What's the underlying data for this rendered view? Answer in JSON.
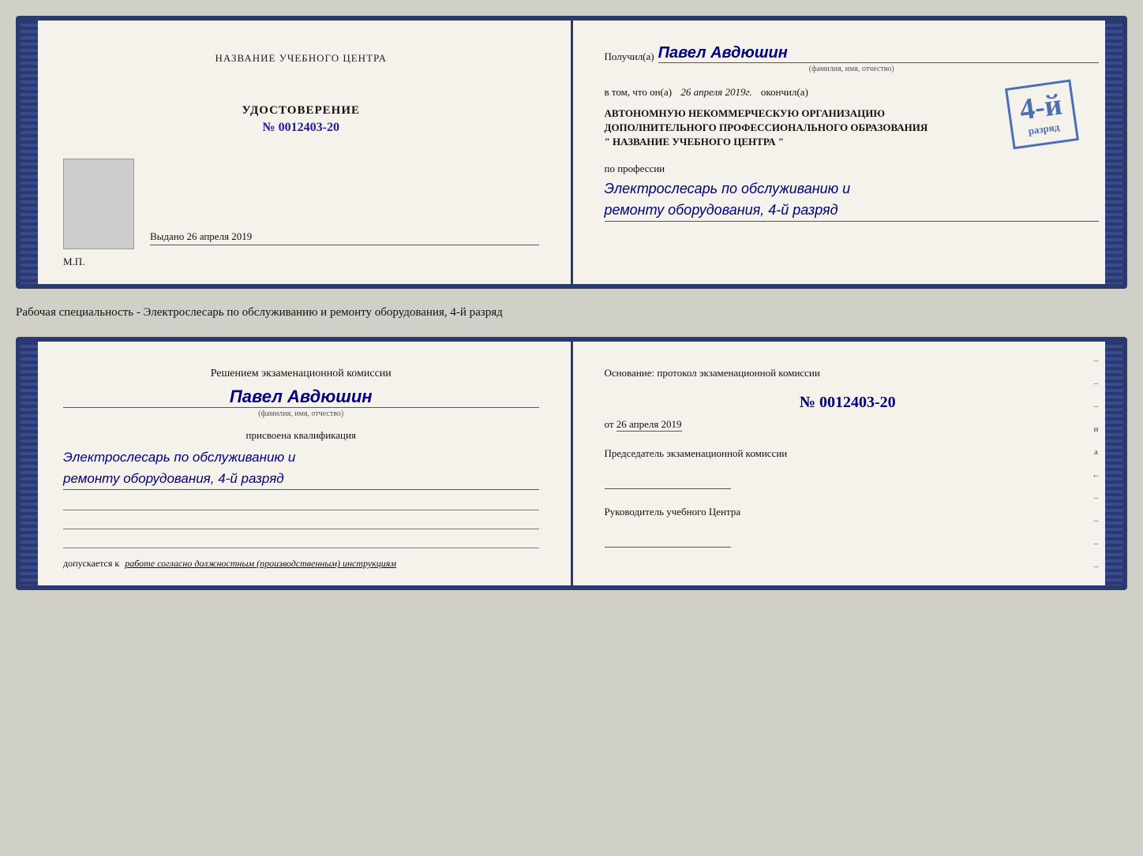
{
  "top_doc": {
    "left": {
      "school_name": "НАЗВАНИЕ УЧЕБНОГО ЦЕНТРА",
      "cert_title": "УДОСТОВЕРЕНИЕ",
      "cert_number": "№ 0012403-20",
      "issued_label": "Выдано",
      "issued_date": "26 апреля 2019",
      "mp_label": "М.П."
    },
    "right": {
      "received_label": "Получил(а)",
      "received_name": "Павел Авдюшин",
      "fio_hint": "(фамилия, имя, отчество)",
      "vtom_label": "в том, что он(а)",
      "vtom_date": "26 апреля 2019г.",
      "finished_label": "окончил(а)",
      "grade_number": "4-й",
      "org_line1": "АВТОНОМНУЮ НЕКОММЕРЧЕСКУЮ ОРГАНИЗАЦИЮ",
      "org_line2": "ДОПОЛНИТЕЛЬНОГО ПРОФЕССИОНАЛЬНОГО ОБРАЗОВАНИЯ",
      "org_name": "\"  НАЗВАНИЕ УЧЕБНОГО ЦЕНТРА  \"",
      "profession_label": "по профессии",
      "profession_line1": "Электрослесарь по обслуживанию и",
      "profession_line2": "ремонту оборудования, 4-й разряд",
      "stamp_text": "разряд"
    }
  },
  "middle": {
    "text": "Рабочая специальность - Электрослесарь по обслуживанию и ремонту оборудования, 4-й разряд"
  },
  "bottom_doc": {
    "left": {
      "decision_title": "Решением экзаменационной комиссии",
      "person_name": "Павел Авдюшин",
      "fio_hint": "(фамилия, имя, отчество)",
      "assigned_label": "присвоена квалификация",
      "qualification_line1": "Электрослесарь по обслуживанию и",
      "qualification_line2": "ремонту оборудования, 4-й разряд",
      "допускается_prefix": "допускается к",
      "допускается_text": "работе согласно должностным (производственным) инструкциям"
    },
    "right": {
      "osnov_label": "Основание: протокол экзаменационной комиссии",
      "protocol_number": "№  0012403-20",
      "date_prefix": "от",
      "date_value": "26 апреля 2019",
      "chairman_label": "Председатель экзаменационной комиссии",
      "director_label": "Руководитель учебного Центра"
    },
    "side_letters": [
      "и",
      "а",
      "←",
      "–",
      "–",
      "–",
      "–",
      "–"
    ]
  }
}
